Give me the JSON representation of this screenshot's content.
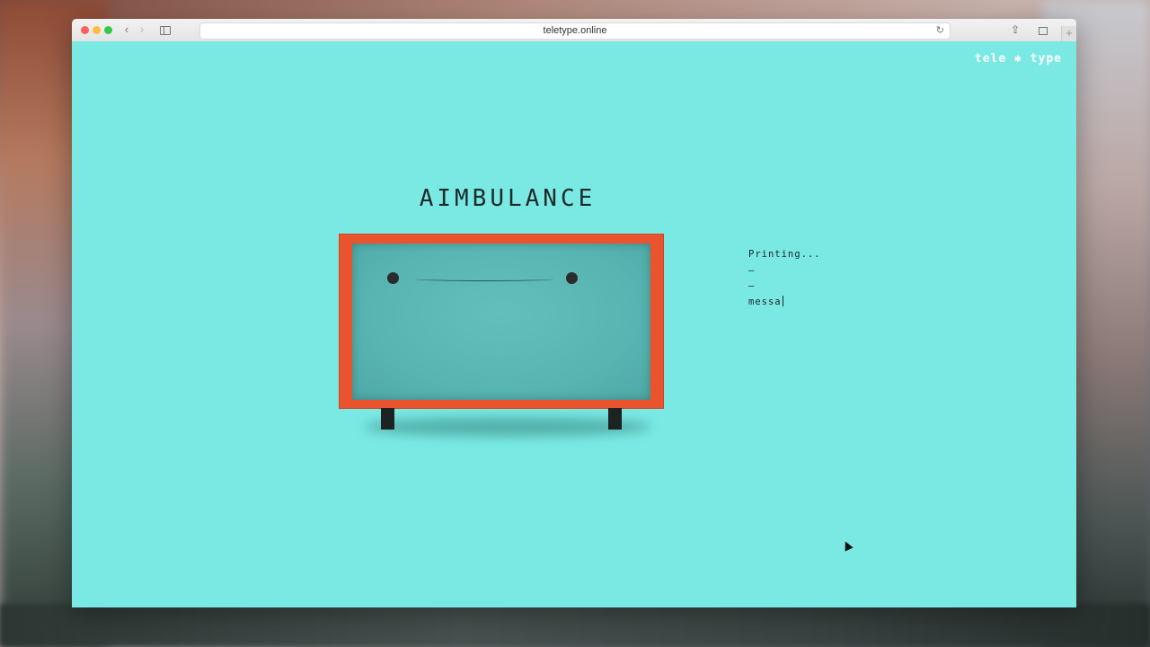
{
  "browser": {
    "url": "teletype.online",
    "back_glyph": "‹",
    "forward_glyph": "›",
    "reload_glyph": "↻",
    "share_glyph": "⇪",
    "newtab_glyph": "+"
  },
  "page": {
    "logo": "tele ✱ type",
    "title": "AIMBULANCE",
    "output_lines": [
      "Printing...",
      "–",
      "–",
      "messa"
    ]
  },
  "colors": {
    "background": "#7ae9e4",
    "device_frame": "#e9542f",
    "screen": "#58b5b2"
  }
}
